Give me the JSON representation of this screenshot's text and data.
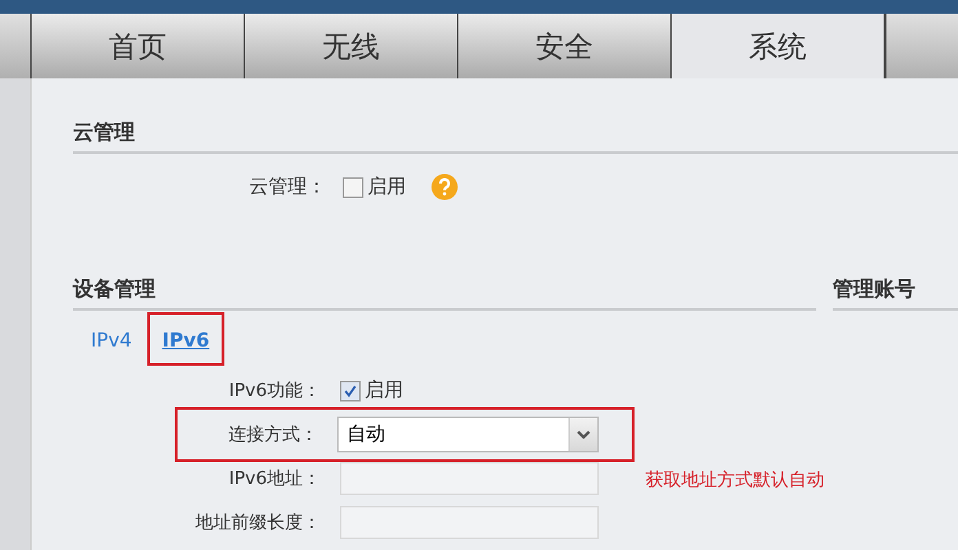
{
  "tabs": [
    {
      "label": "首页",
      "selected": false
    },
    {
      "label": "无线",
      "selected": false
    },
    {
      "label": "安全",
      "selected": false
    },
    {
      "label": "系统",
      "selected": true
    }
  ],
  "cloud": {
    "heading": "云管理",
    "label": "云管理：",
    "checkbox_label": "启用",
    "checked": false
  },
  "device": {
    "heading": "设备管理",
    "subtabs": [
      {
        "label": "IPv4",
        "selected": false,
        "highlighted": false
      },
      {
        "label": "IPv6",
        "selected": true,
        "highlighted": true
      }
    ],
    "fields": [
      {
        "kind": "checkbox",
        "label": "IPv6功能：",
        "checkbox_label": "启用",
        "checked": true,
        "highlighted": false
      },
      {
        "kind": "select",
        "label": "连接方式：",
        "value": "自动",
        "highlighted": true
      },
      {
        "kind": "text",
        "label": "IPv6地址：",
        "highlighted": false
      },
      {
        "kind": "text",
        "label": "地址前缀长度：",
        "highlighted": false
      }
    ]
  },
  "account": {
    "heading": "管理账号"
  },
  "annotation": "获取地址方式默认自动"
}
